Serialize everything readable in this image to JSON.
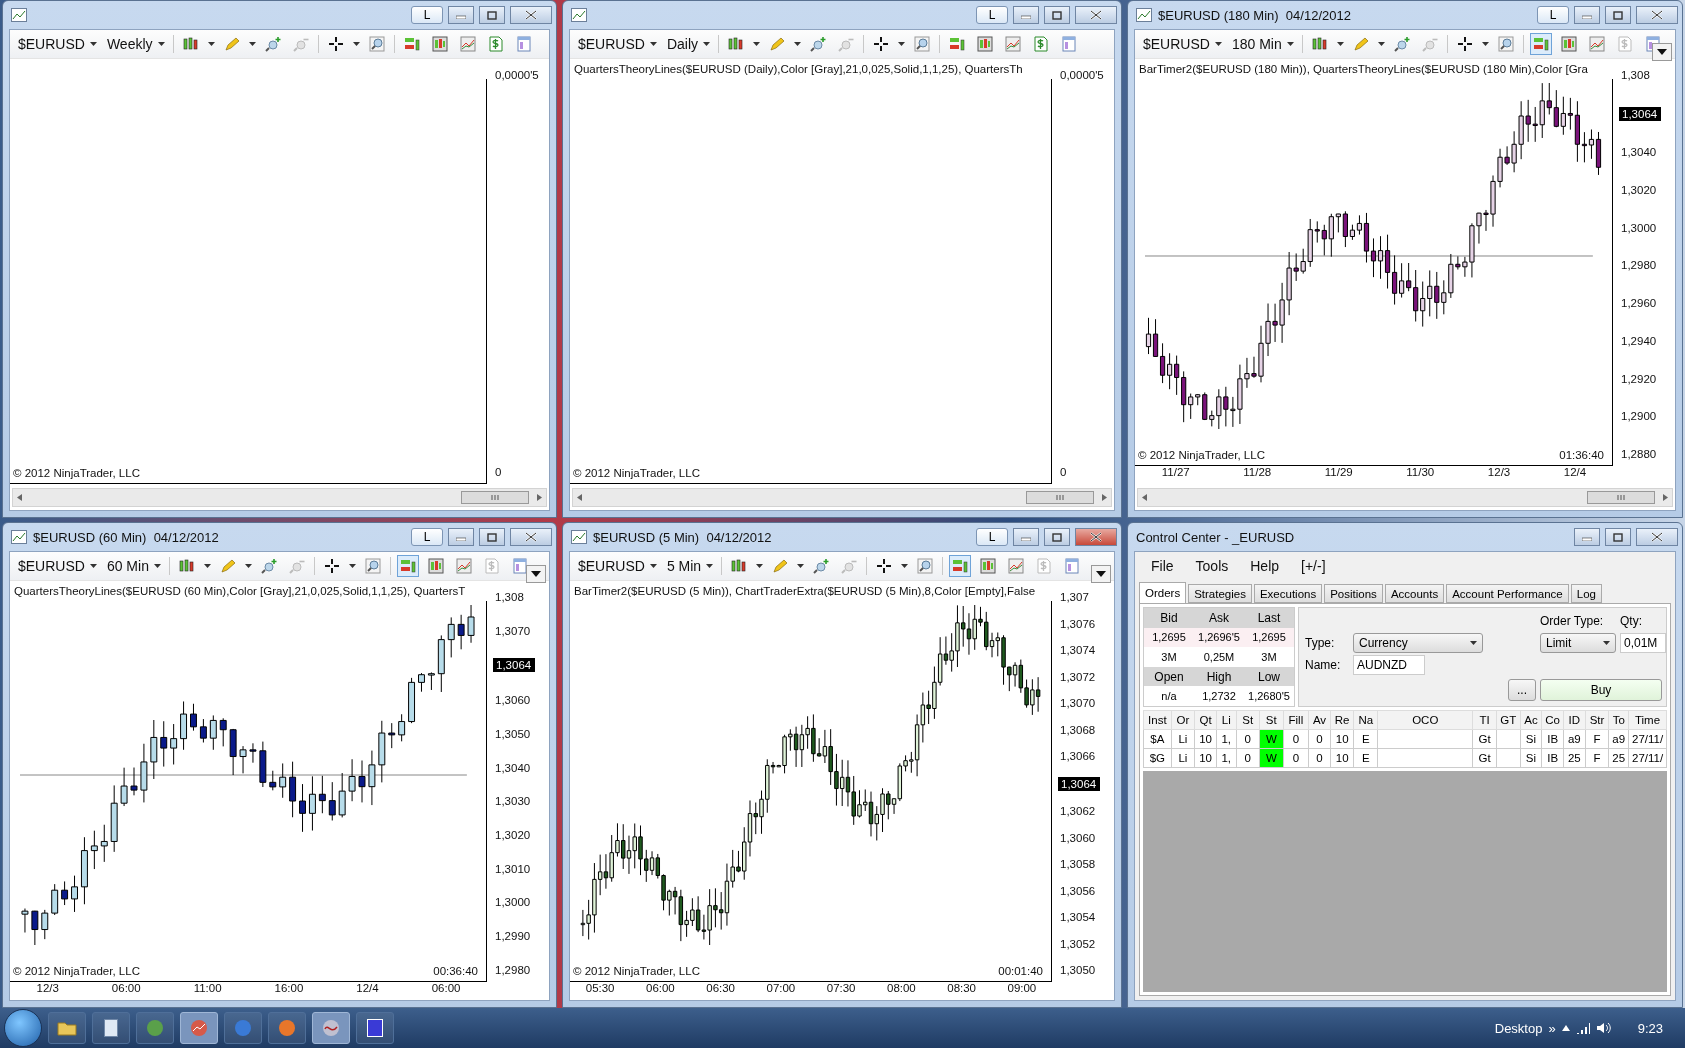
{
  "charts": [
    {
      "kind": "empty",
      "link_label": "L",
      "symbol": "$EURUSD",
      "interval": "Weekly",
      "chart_trader_on": false,
      "y_labels": [
        {
          "kind": "label",
          "text": "0,0000'5"
        },
        {
          "kind": "label",
          "text": "0"
        }
      ],
      "copyright": "© 2012 NinjaTrader, LLC",
      "scrollbar": true
    },
    {
      "kind": "empty",
      "link_label": "L",
      "symbol": "$EURUSD",
      "interval": "Daily",
      "chart_trader_on": false,
      "indicator": "QuartersTheoryLines($EURUSD (Daily),Color [Gray],21,0,025,Solid,1,1,25), QuartersTh",
      "y_labels": [
        {
          "kind": "label",
          "text": "0,0000'5"
        },
        {
          "kind": "label",
          "text": "0"
        }
      ],
      "copyright": "© 2012 NinjaTrader, LLC",
      "scrollbar": true
    },
    {
      "kind": "candles",
      "title": "$EURUSD (180 Min)  04/12/2012",
      "link_label": "L",
      "symbol": "$EURUSD",
      "interval": "180 Min",
      "chart_trader_on": true,
      "indicator": "BarTimer2($EURUSD (180 Min)), QuartersTheoryLines($EURUSD (180 Min),Color [Gra",
      "y_labels": [
        {
          "kind": "label",
          "text": "1,308"
        },
        {
          "kind": "tag",
          "text": "1,3064"
        },
        {
          "kind": "label",
          "text": "1,3040"
        },
        {
          "kind": "label",
          "text": "1,3020"
        },
        {
          "kind": "label",
          "text": "1,3000"
        },
        {
          "kind": "label",
          "text": "1,2980"
        },
        {
          "kind": "label",
          "text": "1,2960"
        },
        {
          "kind": "label",
          "text": "1,2940"
        },
        {
          "kind": "label",
          "text": "1,2920"
        },
        {
          "kind": "label",
          "text": "1,2900"
        },
        {
          "kind": "label",
          "text": "1,2880"
        }
      ],
      "x_labels": [
        "11/27",
        "11/28",
        "11/29",
        "11/30",
        "12/3",
        "12/4"
      ],
      "timer": "01:36:40",
      "copyright": "© 2012 NinjaTrader, LLC",
      "scrollbar": true
    },
    {
      "kind": "candles",
      "title": "$EURUSD (60 Min)  04/12/2012",
      "link_label": "L",
      "symbol": "$EURUSD",
      "interval": "60 Min",
      "chart_trader_on": true,
      "indicator": "QuartersTheoryLines($EURUSD (60 Min),Color [Gray],21,0,025,Solid,1,1,25), QuartersT",
      "y_labels": [
        {
          "kind": "label",
          "text": "1,308"
        },
        {
          "kind": "label",
          "text": "1,3070"
        },
        {
          "kind": "tag",
          "text": "1,3064"
        },
        {
          "kind": "label",
          "text": "1,3060"
        },
        {
          "kind": "label",
          "text": "1,3050"
        },
        {
          "kind": "label",
          "text": "1,3040"
        },
        {
          "kind": "label",
          "text": "1,3030"
        },
        {
          "kind": "label",
          "text": "1,3020"
        },
        {
          "kind": "label",
          "text": "1,3010"
        },
        {
          "kind": "label",
          "text": "1,3000"
        },
        {
          "kind": "label",
          "text": "1,2990"
        },
        {
          "kind": "label",
          "text": "1,2980"
        }
      ],
      "x_labels": [
        "12/3",
        "06:00",
        "11:00",
        "16:00",
        "12/4",
        "06:00"
      ],
      "timer": "00:36:40",
      "copyright": "© 2012 NinjaTrader, LLC",
      "scrollbar": false
    },
    {
      "kind": "candles",
      "title": "$EURUSD (5 Min)  04/12/2012",
      "link_label": "L",
      "symbol": "$EURUSD",
      "interval": "5 Min",
      "chart_trader_on": true,
      "indicator": "BarTimer2($EURUSD (5 Min)), ChartTraderExtra($EURUSD (5 Min),8,Color [Empty],False",
      "y_labels": [
        {
          "kind": "label",
          "text": "1,307"
        },
        {
          "kind": "label",
          "text": "1,3076"
        },
        {
          "kind": "label",
          "text": "1,3074"
        },
        {
          "kind": "label",
          "text": "1,3072"
        },
        {
          "kind": "label",
          "text": "1,3070"
        },
        {
          "kind": "label",
          "text": "1,3068"
        },
        {
          "kind": "label",
          "text": "1,3066"
        },
        {
          "kind": "tag",
          "text": "1,3064"
        },
        {
          "kind": "label",
          "text": "1,3062"
        },
        {
          "kind": "label",
          "text": "1,3060"
        },
        {
          "kind": "label",
          "text": "1,3058"
        },
        {
          "kind": "label",
          "text": "1,3056"
        },
        {
          "kind": "label",
          "text": "1,3054"
        },
        {
          "kind": "label",
          "text": "1,3052"
        },
        {
          "kind": "label",
          "text": "1,3050"
        }
      ],
      "x_labels": [
        "05:30",
        "06:00",
        "06:30",
        "07:00",
        "07:30",
        "08:00",
        "08:30",
        "09:00"
      ],
      "timer": "00:01:40",
      "copyright": "© 2012 NinjaTrader, LLC",
      "scrollbar": false
    }
  ],
  "control_center": {
    "title": "Control Center - _EURUSD",
    "menu": [
      "File",
      "Tools",
      "Help",
      "[+/-]"
    ],
    "tabs": [
      {
        "label": "Orders",
        "selected": true
      },
      {
        "label": "Strategies",
        "selected": false
      },
      {
        "label": "Executions",
        "selected": false
      },
      {
        "label": "Positions",
        "selected": false
      },
      {
        "label": "Accounts",
        "selected": false
      },
      {
        "label": "Account Performance",
        "selected": false
      },
      {
        "label": "Log",
        "selected": false
      }
    ],
    "quote": {
      "headers": [
        "Bid",
        "Ask",
        "Last"
      ],
      "prices": [
        "1,2695",
        "1,2696'5",
        "1,2695"
      ],
      "sizes": [
        "3M",
        "0,25M",
        "3M"
      ],
      "range_headers": [
        "Open",
        "High",
        "Low"
      ],
      "range_values": [
        "n/a",
        "1,2732",
        "1,2680'5"
      ]
    },
    "order_entry": {
      "type_label": "Type:",
      "type_value": "Currency",
      "order_type_label": "Order Type:",
      "order_type_value": "Limit",
      "qty_label": "Qty:",
      "qty_value": "0,01M",
      "name_label": "Name:",
      "name_value": "AUDNZD",
      "more_button": "...",
      "buy_button": "Buy"
    },
    "orders": {
      "columns": [
        "Inst",
        "Or",
        "Qt",
        "Li",
        "St",
        "St",
        "Fill",
        "Av",
        "Re",
        "Na",
        "OCO",
        "TI",
        "GT",
        "Ac",
        "Co",
        "ID",
        "Str",
        "To",
        "Time"
      ],
      "rows": [
        {
          "cells": [
            "$A",
            "Li",
            "10",
            "1,",
            "0",
            "W",
            "0",
            "0",
            "10",
            "E",
            null,
            "Gt",
            null,
            "Si",
            "IB",
            "a9",
            "F",
            "a9",
            "27/11/"
          ]
        },
        {
          "cells": [
            "$G",
            "Li",
            "10",
            "1,",
            "0",
            "W",
            "0",
            "0",
            "10",
            "E",
            null,
            "Gt",
            null,
            "Si",
            "IB",
            "25",
            "F",
            "25",
            "27/11/"
          ]
        }
      ]
    }
  },
  "taskbar": {
    "desktop_label": "Desktop",
    "chevron": "»",
    "clock": "9:23"
  }
}
